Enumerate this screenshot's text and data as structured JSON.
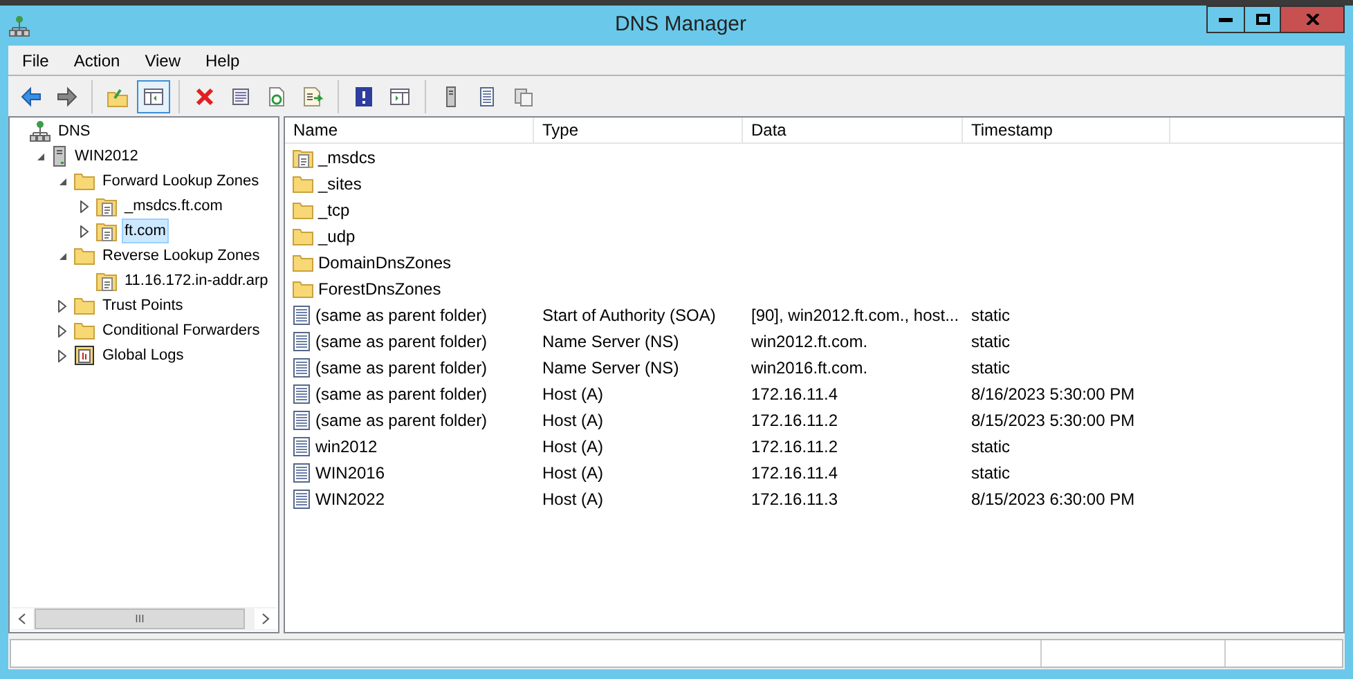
{
  "window": {
    "title": "DNS Manager"
  },
  "menu": [
    "File",
    "Action",
    "View",
    "Help"
  ],
  "toolbar": [
    {
      "kind": "back"
    },
    {
      "kind": "forward"
    },
    {
      "kind": "sep"
    },
    {
      "kind": "up"
    },
    {
      "kind": "pane",
      "selected": true
    },
    {
      "kind": "sep"
    },
    {
      "kind": "delete"
    },
    {
      "kind": "props"
    },
    {
      "kind": "refresh"
    },
    {
      "kind": "export"
    },
    {
      "kind": "sep"
    },
    {
      "kind": "help"
    },
    {
      "kind": "pane2"
    },
    {
      "kind": "sep"
    },
    {
      "kind": "server"
    },
    {
      "kind": "list"
    },
    {
      "kind": "copy"
    }
  ],
  "tree": [
    {
      "label": "DNS",
      "kind": "dns",
      "selected": false,
      "children": [
        {
          "label": "WIN2012",
          "kind": "server",
          "selected": false,
          "expanded": true,
          "children": [
            {
              "label": "Forward Lookup Zones",
              "kind": "folder",
              "selected": false,
              "expanded": true,
              "children": [
                {
                  "label": "_msdcs.ft.com",
                  "kind": "zone",
                  "selected": false,
                  "expanded": false
                },
                {
                  "label": "ft.com",
                  "kind": "zone",
                  "selected": true,
                  "expanded": false
                }
              ]
            },
            {
              "label": "Reverse Lookup Zones",
              "kind": "folder",
              "selected": false,
              "expanded": true,
              "children": [
                {
                  "label": "11.16.172.in-addr.arp",
                  "kind": "zone",
                  "selected": false
                }
              ]
            },
            {
              "label": "Trust Points",
              "kind": "folder",
              "selected": false,
              "expanded": false
            },
            {
              "label": "Conditional Forwarders",
              "kind": "folder",
              "selected": false,
              "expanded": false
            },
            {
              "label": "Global Logs",
              "kind": "log",
              "selected": false,
              "expanded": false
            }
          ]
        }
      ]
    }
  ],
  "table": {
    "columns": [
      "Name",
      "Type",
      "Data",
      "Timestamp"
    ],
    "rows": [
      {
        "kind": "zone",
        "name": "_msdcs"
      },
      {
        "kind": "folder",
        "name": "_sites"
      },
      {
        "kind": "folder",
        "name": "_tcp"
      },
      {
        "kind": "folder",
        "name": "_udp"
      },
      {
        "kind": "folder",
        "name": "DomainDnsZones"
      },
      {
        "kind": "folder",
        "name": "ForestDnsZones"
      },
      {
        "kind": "record",
        "name": "(same as parent folder)",
        "type": "Start of Authority (SOA)",
        "data": "[90], win2012.ft.com., host...",
        "timestamp": "static"
      },
      {
        "kind": "record",
        "name": "(same as parent folder)",
        "type": "Name Server (NS)",
        "data": "win2012.ft.com.",
        "timestamp": "static"
      },
      {
        "kind": "record",
        "name": "(same as parent folder)",
        "type": "Name Server (NS)",
        "data": "win2016.ft.com.",
        "timestamp": "static"
      },
      {
        "kind": "record",
        "name": "(same as parent folder)",
        "type": "Host (A)",
        "data": "172.16.11.4",
        "timestamp": "8/16/2023 5:30:00 PM"
      },
      {
        "kind": "record",
        "name": "(same as parent folder)",
        "type": "Host (A)",
        "data": "172.16.11.2",
        "timestamp": "8/15/2023 5:30:00 PM"
      },
      {
        "kind": "record",
        "name": "win2012",
        "type": "Host (A)",
        "data": "172.16.11.2",
        "timestamp": "static"
      },
      {
        "kind": "record",
        "name": "WIN2016",
        "type": "Host (A)",
        "data": "172.16.11.4",
        "timestamp": "static"
      },
      {
        "kind": "record",
        "name": "WIN2022",
        "type": "Host (A)",
        "data": "172.16.11.3",
        "timestamp": "8/15/2023 6:30:00 PM"
      }
    ]
  },
  "tree_scrollbar": {
    "thumb_glyph": "III"
  }
}
